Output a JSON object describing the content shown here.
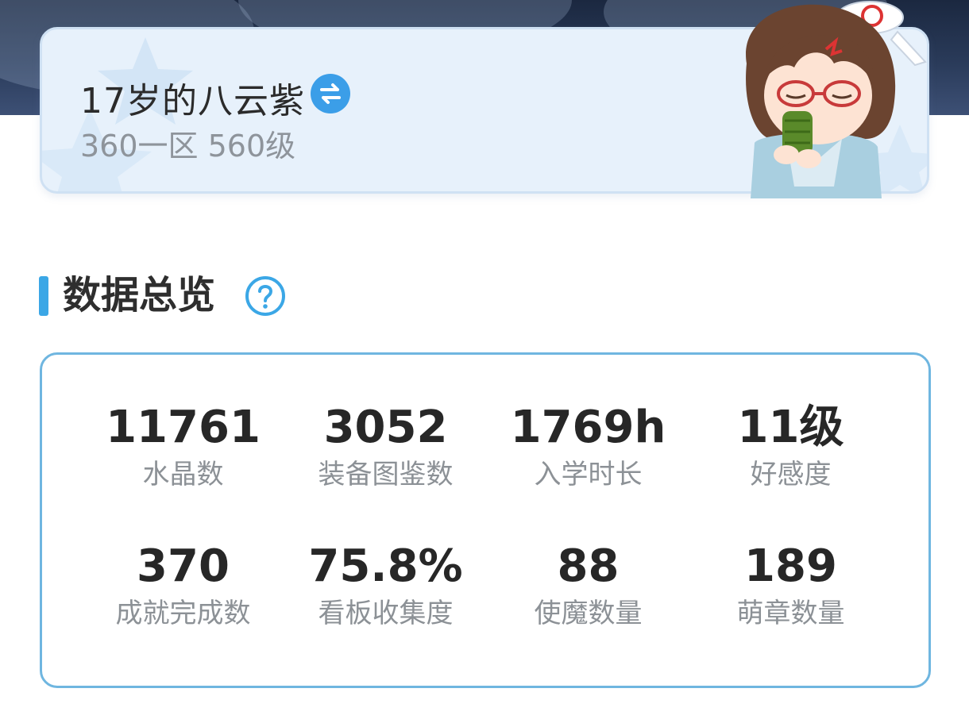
{
  "profile": {
    "name": "17岁的八云紫",
    "server_level": "360一区 560级"
  },
  "overview": {
    "title": "数据总览"
  },
  "stats": [
    {
      "value": "11761",
      "label": "水晶数"
    },
    {
      "value": "3052",
      "label": "装备图鉴数"
    },
    {
      "value": "1769h",
      "label": "入学时长"
    },
    {
      "value": "11级",
      "label": "好感度"
    },
    {
      "value": "370",
      "label": "成就完成数"
    },
    {
      "value": "75.8%",
      "label": "看板收集度"
    },
    {
      "value": "88",
      "label": "使魔数量"
    },
    {
      "value": "189",
      "label": "萌章数量"
    }
  ],
  "icons": {
    "switch": "swap-arrows-icon",
    "help": "question-mark-icon"
  },
  "colors": {
    "accent": "#3ba7e6",
    "card_bg": "#e7f1fb",
    "panel_border": "#6fb6e0",
    "text_primary": "#272727",
    "text_secondary": "#8c9196"
  }
}
